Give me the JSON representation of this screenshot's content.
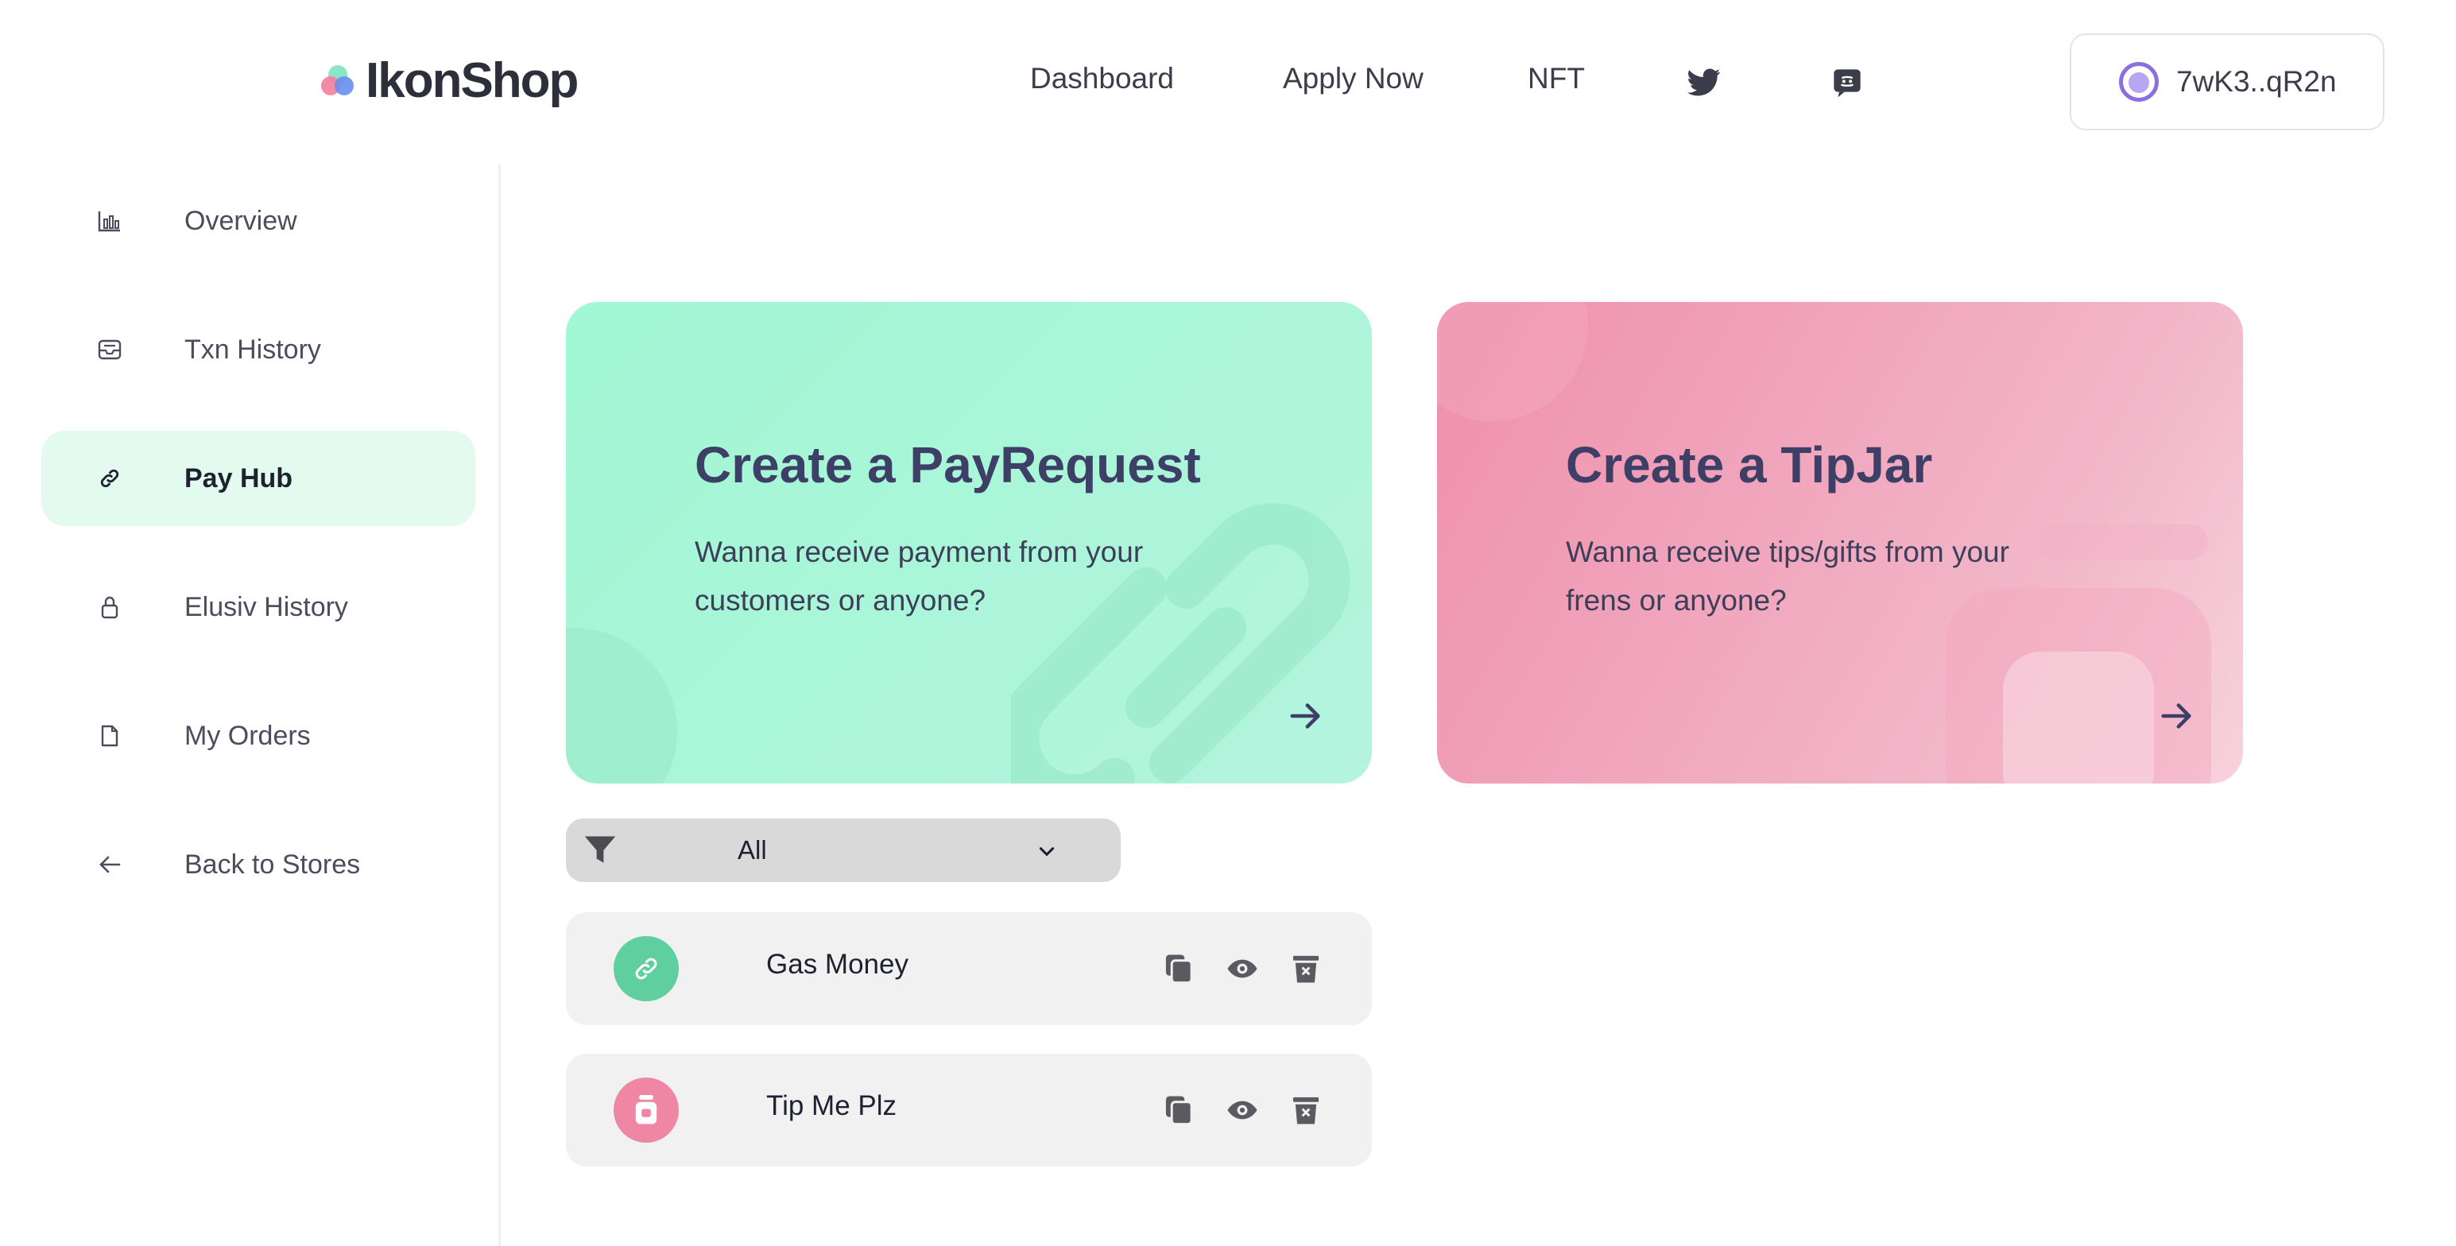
{
  "header": {
    "brand": "IkonShop",
    "nav": [
      {
        "label": "Dashboard"
      },
      {
        "label": "Apply Now"
      },
      {
        "label": "NFT"
      }
    ],
    "social_icons": [
      "twitter-icon",
      "discord-icon"
    ],
    "wallet": {
      "address": "7wK3..qR2n",
      "icon": "wallet-avatar-icon"
    }
  },
  "sidebar": {
    "items": [
      {
        "label": "Overview",
        "icon": "bar-chart-icon",
        "active": false
      },
      {
        "label": "Txn History",
        "icon": "inbox-icon",
        "active": false
      },
      {
        "label": "Pay Hub",
        "icon": "link-icon",
        "active": true
      },
      {
        "label": "Elusiv History",
        "icon": "lock-icon",
        "active": false
      },
      {
        "label": "My Orders",
        "icon": "file-icon",
        "active": false
      },
      {
        "label": "Back to Stores",
        "icon": "arrow-left-icon",
        "active": false
      }
    ]
  },
  "cards": {
    "payrequest": {
      "title": "Create a PayRequest",
      "description": "Wanna receive payment from your customers or anyone?",
      "icon": "arrow-right-icon"
    },
    "tipjar": {
      "title": "Create a TipJar",
      "description": "Wanna receive tips/gifts from your frens or anyone?",
      "icon": "arrow-right-icon"
    }
  },
  "filter": {
    "selected": "All",
    "icon": "funnel-icon"
  },
  "list": [
    {
      "label": "Gas Money",
      "type_icon": "link-icon",
      "badge_color": "#5fcf9f"
    },
    {
      "label": "Tip Me Plz",
      "type_icon": "jar-icon",
      "badge_color": "#ef86a3"
    }
  ],
  "colors": {
    "accent_green": "#a1f7d4",
    "accent_pink": "#ef8fab",
    "active_nav_bg": "#e3fbef",
    "wallet_accent": "#8b6fe0"
  }
}
